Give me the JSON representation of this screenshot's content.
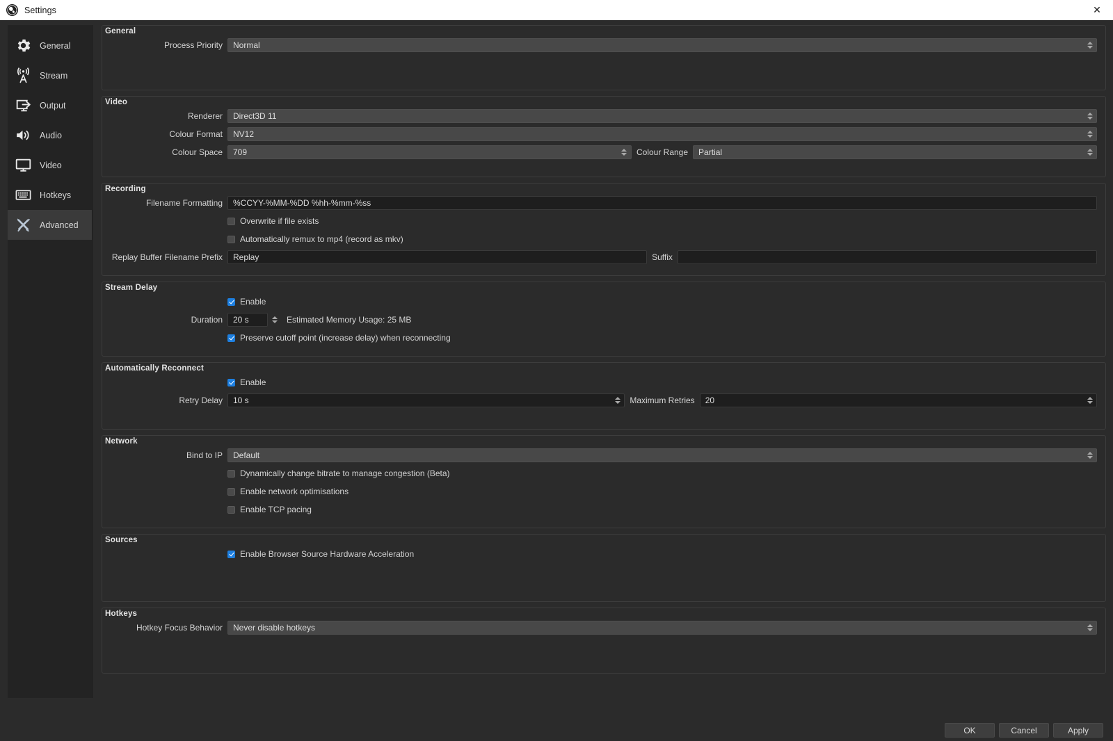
{
  "window": {
    "title": "Settings",
    "logo_icon": "obs-logo-icon",
    "close_icon": "close-icon"
  },
  "sidebar": {
    "items": [
      {
        "label": "General",
        "icon": "gear-icon",
        "selected": false
      },
      {
        "label": "Stream",
        "icon": "broadcast-icon",
        "selected": false
      },
      {
        "label": "Output",
        "icon": "output-icon",
        "selected": false
      },
      {
        "label": "Audio",
        "icon": "speaker-icon",
        "selected": false
      },
      {
        "label": "Video",
        "icon": "monitor-icon",
        "selected": false
      },
      {
        "label": "Hotkeys",
        "icon": "keyboard-icon",
        "selected": false
      },
      {
        "label": "Advanced",
        "icon": "tools-icon",
        "selected": true
      }
    ]
  },
  "sections": {
    "general": {
      "title": "General",
      "process_priority_label": "Process Priority",
      "process_priority_value": "Normal"
    },
    "video": {
      "title": "Video",
      "renderer_label": "Renderer",
      "renderer_value": "Direct3D 11",
      "colour_format_label": "Colour Format",
      "colour_format_value": "NV12",
      "colour_space_label": "Colour Space",
      "colour_space_value": "709",
      "colour_range_label": "Colour Range",
      "colour_range_value": "Partial"
    },
    "recording": {
      "title": "Recording",
      "filename_formatting_label": "Filename Formatting",
      "filename_formatting_value": "%CCYY-%MM-%DD %hh-%mm-%ss",
      "overwrite_label": "Overwrite if file exists",
      "overwrite_checked": false,
      "remux_label": "Automatically remux to mp4 (record as mkv)",
      "remux_checked": false,
      "replay_prefix_label": "Replay Buffer Filename Prefix",
      "replay_prefix_value": "Replay",
      "suffix_label": "Suffix",
      "suffix_value": ""
    },
    "stream_delay": {
      "title": "Stream Delay",
      "enable_label": "Enable",
      "enable_checked": true,
      "duration_label": "Duration",
      "duration_value": "20 s",
      "memory_usage": "Estimated Memory Usage: 25 MB",
      "preserve_label": "Preserve cutoff point (increase delay) when reconnecting",
      "preserve_checked": true
    },
    "reconnect": {
      "title": "Automatically Reconnect",
      "enable_label": "Enable",
      "enable_checked": true,
      "retry_delay_label": "Retry Delay",
      "retry_delay_value": "10 s",
      "max_retries_label": "Maximum Retries",
      "max_retries_value": "20"
    },
    "network": {
      "title": "Network",
      "bind_ip_label": "Bind to IP",
      "bind_ip_value": "Default",
      "dynamic_bitrate_label": "Dynamically change bitrate to manage congestion (Beta)",
      "dynamic_bitrate_checked": false,
      "network_optimisations_label": "Enable network optimisations",
      "network_optimisations_checked": false,
      "tcp_pacing_label": "Enable TCP pacing",
      "tcp_pacing_checked": false
    },
    "sources": {
      "title": "Sources",
      "browser_hwaccel_label": "Enable Browser Source Hardware Acceleration",
      "browser_hwaccel_checked": true
    },
    "hotkeys": {
      "title": "Hotkeys",
      "focus_behavior_label": "Hotkey Focus Behavior",
      "focus_behavior_value": "Never disable hotkeys"
    }
  },
  "footer": {
    "ok_label": "OK",
    "cancel_label": "Cancel",
    "apply_label": "Apply"
  },
  "colors": {
    "accent": "#1d7fe0",
    "window_bg": "#2b2b2b",
    "sidebar_bg": "#232323",
    "titlebar_bg": "#ffffff"
  }
}
